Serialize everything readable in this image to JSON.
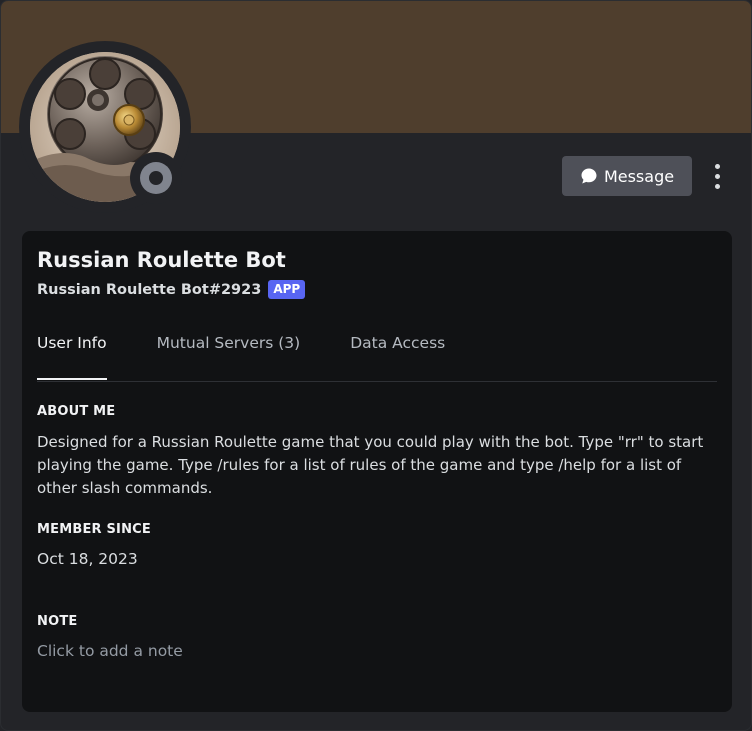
{
  "header": {
    "banner_color": "#4f3e2d",
    "status": "offline",
    "message_button_label": "Message",
    "message_icon": "chat-bubble-icon",
    "more_icon": "more-vertical-icon"
  },
  "profile": {
    "display_name": "Russian Roulette Bot",
    "username": "Russian Roulette Bot#2923",
    "badge": "APP",
    "badge_color": "#5865f2"
  },
  "tabs": [
    {
      "label": "User Info",
      "active": true
    },
    {
      "label": "Mutual Servers (3)",
      "active": false
    },
    {
      "label": "Data Access",
      "active": false
    }
  ],
  "about": {
    "title": "ABOUT ME",
    "text": "Designed for a Russian Roulette game that you could play with the bot. Type \"rr\" to start playing the game. Type /rules for a list of rules of the game and type /help for a list of other slash commands."
  },
  "member_since": {
    "title": "MEMBER SINCE",
    "date": "Oct 18, 2023"
  },
  "note": {
    "title": "NOTE",
    "placeholder": "Click to add a note"
  }
}
